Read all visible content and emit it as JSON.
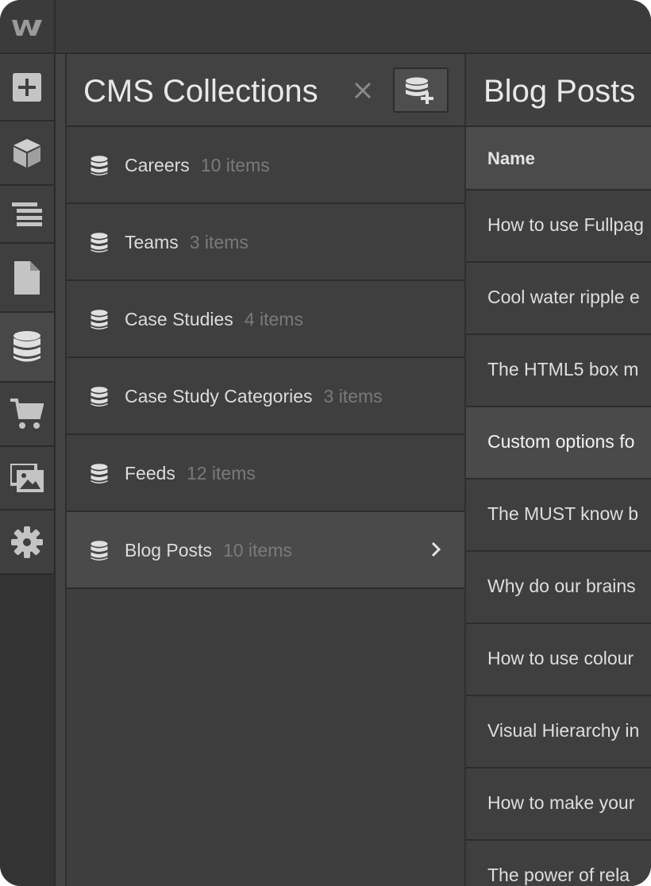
{
  "sidebar": {
    "items": [
      {
        "icon": "add-icon"
      },
      {
        "icon": "box-icon"
      },
      {
        "icon": "navigator-icon"
      },
      {
        "icon": "pages-icon"
      },
      {
        "icon": "database-icon"
      },
      {
        "icon": "cart-icon"
      },
      {
        "icon": "assets-icon"
      },
      {
        "icon": "gear-icon"
      }
    ]
  },
  "collections_panel": {
    "title": "CMS Collections",
    "close_symbol": "×",
    "items": [
      {
        "name": "Careers",
        "count": "10 items"
      },
      {
        "name": "Teams",
        "count": "3 items"
      },
      {
        "name": "Case Studies",
        "count": "4 items"
      },
      {
        "name": "Case Study Categories",
        "count": "3 items"
      },
      {
        "name": "Feeds",
        "count": "12 items"
      },
      {
        "name": "Blog Posts",
        "count": "10 items"
      }
    ]
  },
  "blog_panel": {
    "title": "Blog Posts",
    "column_header": "Name",
    "rows": [
      "How to use Fullpag",
      "Cool water ripple e",
      "The HTML5 box m",
      "Custom options fo",
      "The MUST know b",
      "Why do our brains",
      "How to use colour",
      "Visual Hierarchy in",
      "How to make your",
      "The power of rela"
    ]
  },
  "colors": {
    "background": "#3c3c3c",
    "panel": "#3e3e3e",
    "selected": "#4a4a4a",
    "text": "#dcdcdc",
    "muted": "#7a7a7a"
  }
}
